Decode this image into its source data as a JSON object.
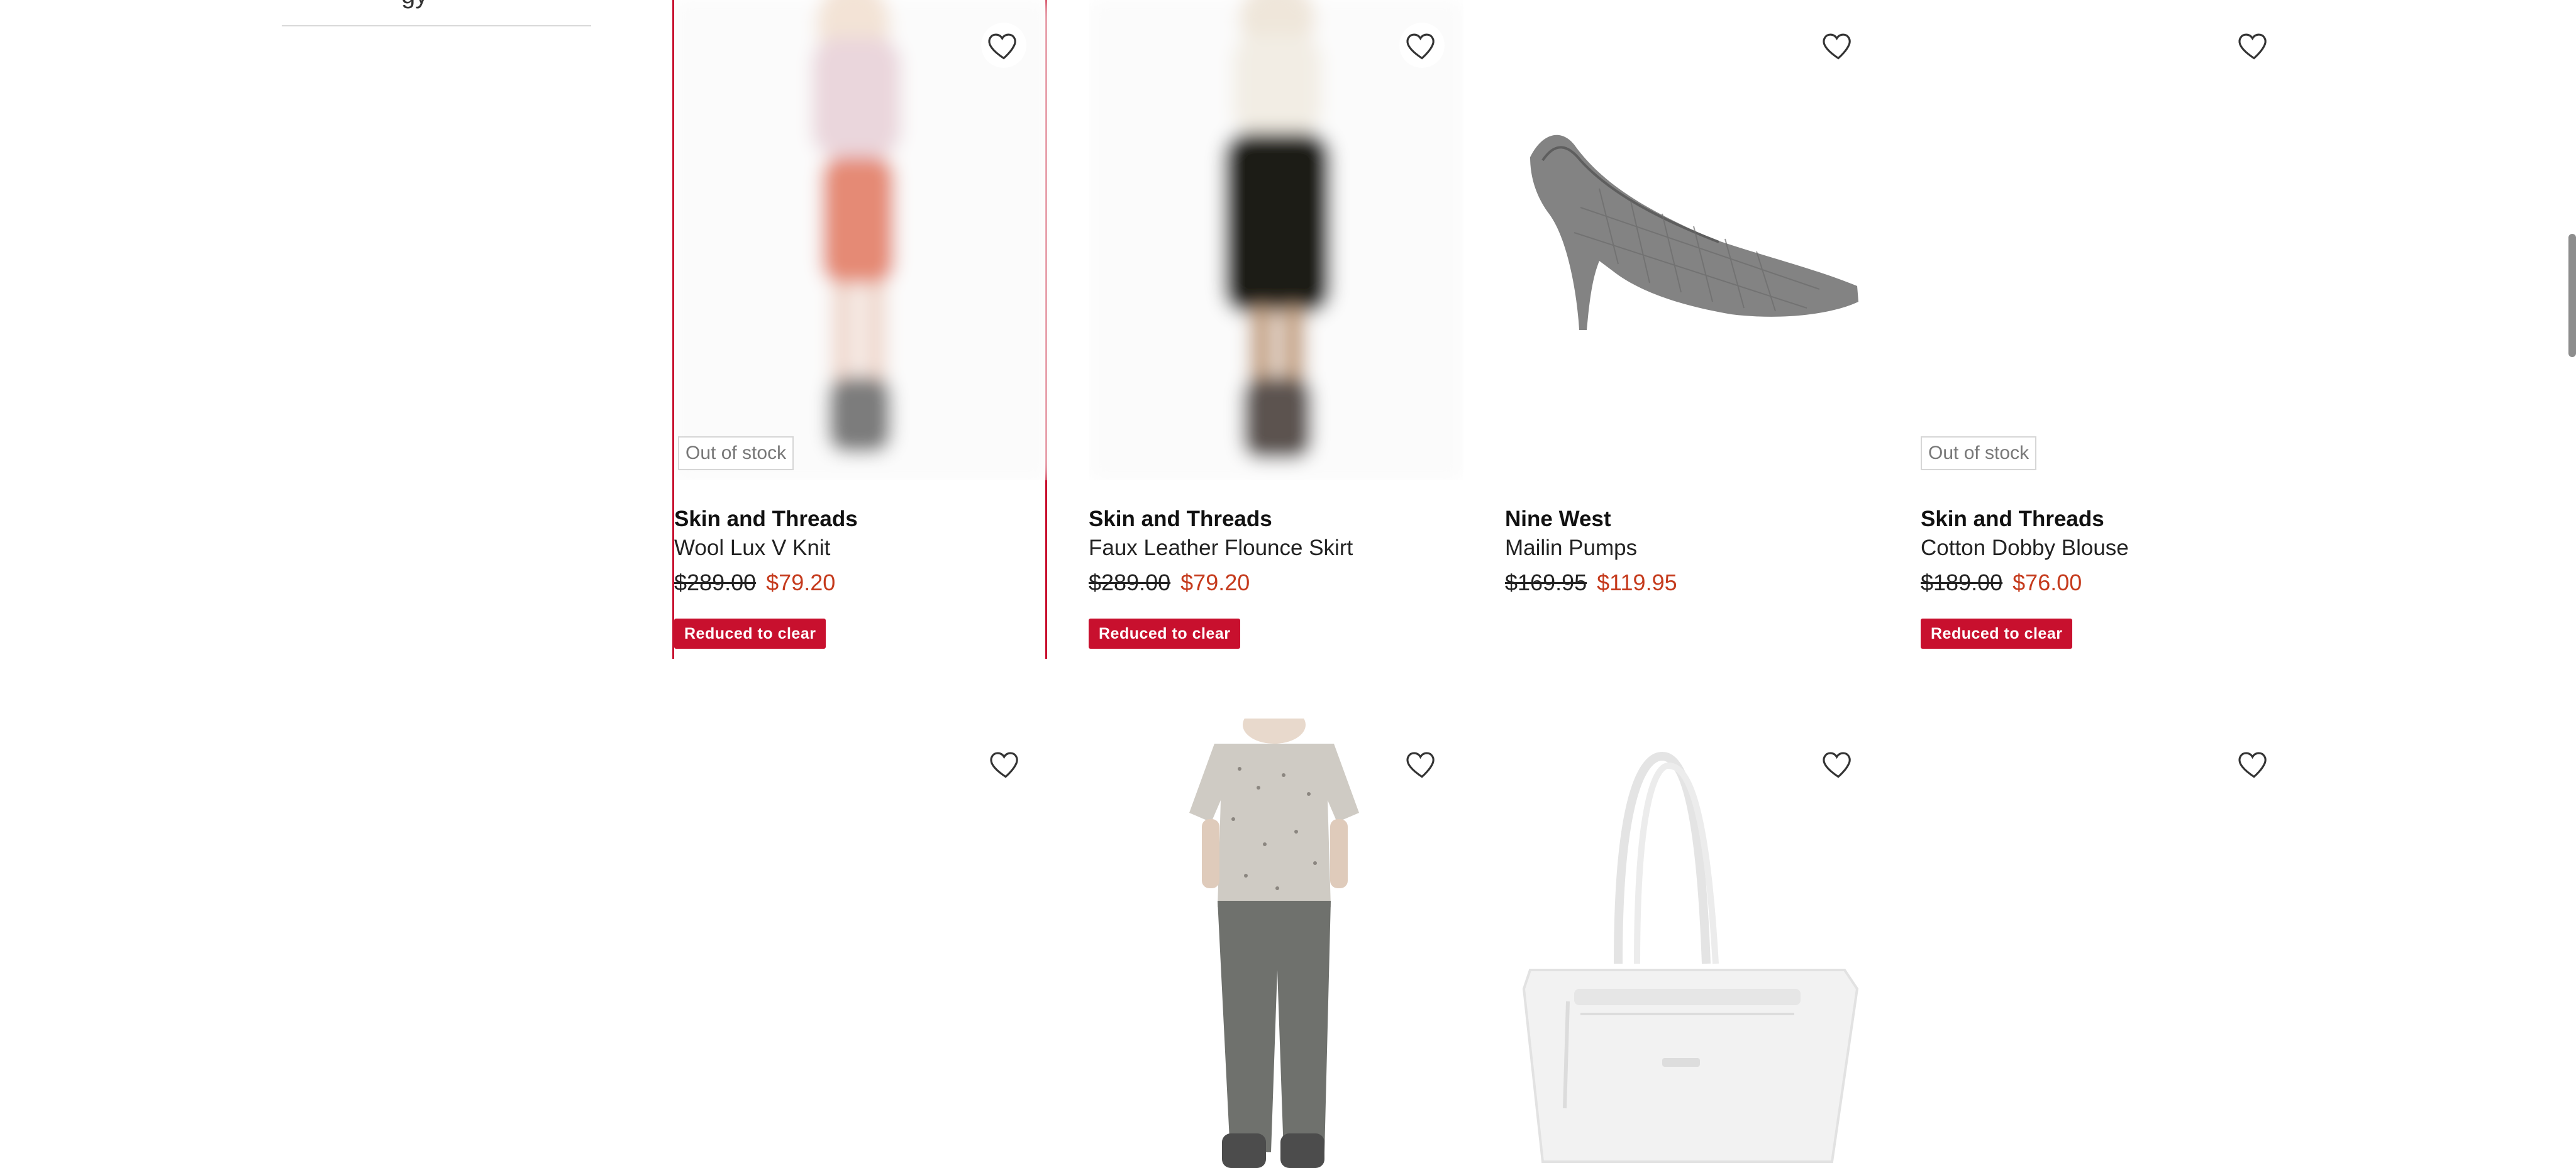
{
  "sidebar": {
    "section_tail_text": "gy"
  },
  "products": [
    {
      "brand": "Skin and Threads",
      "name": "Wool Lux V Knit",
      "price_was": "$289.00",
      "price_now": "$79.20",
      "stock_label": "Out of stock",
      "badge": "Reduced to clear",
      "image": "model-pink-knit-orange-skirt"
    },
    {
      "brand": "Skin and Threads",
      "name": "Faux Leather Flounce Skirt",
      "price_was": "$289.00",
      "price_now": "$79.20",
      "stock_label": "",
      "badge": "Reduced to clear",
      "image": "model-black-flounce-skirt"
    },
    {
      "brand": "Nine West",
      "name": "Mailin Pumps",
      "price_was": "$169.95",
      "price_now": "$119.95",
      "stock_label": "",
      "badge": "",
      "image": "grey-croc-pump-shoe"
    },
    {
      "brand": "Skin and Threads",
      "name": "Cotton Dobby Blouse",
      "price_was": "$189.00",
      "price_now": "$76.00",
      "stock_label": "Out of stock",
      "badge": "Reduced to clear",
      "image": "blank"
    },
    {
      "image": "blank"
    },
    {
      "image": "model-print-tee-grey-pants"
    },
    {
      "image": "white-tote-bag"
    },
    {
      "image": "blank"
    }
  ],
  "colors": {
    "accent_red": "#c8102e",
    "sale_price": "#c53a1c",
    "focus_outline": "#c8102e"
  },
  "icons": {
    "wishlist": "heart-outline-icon"
  }
}
